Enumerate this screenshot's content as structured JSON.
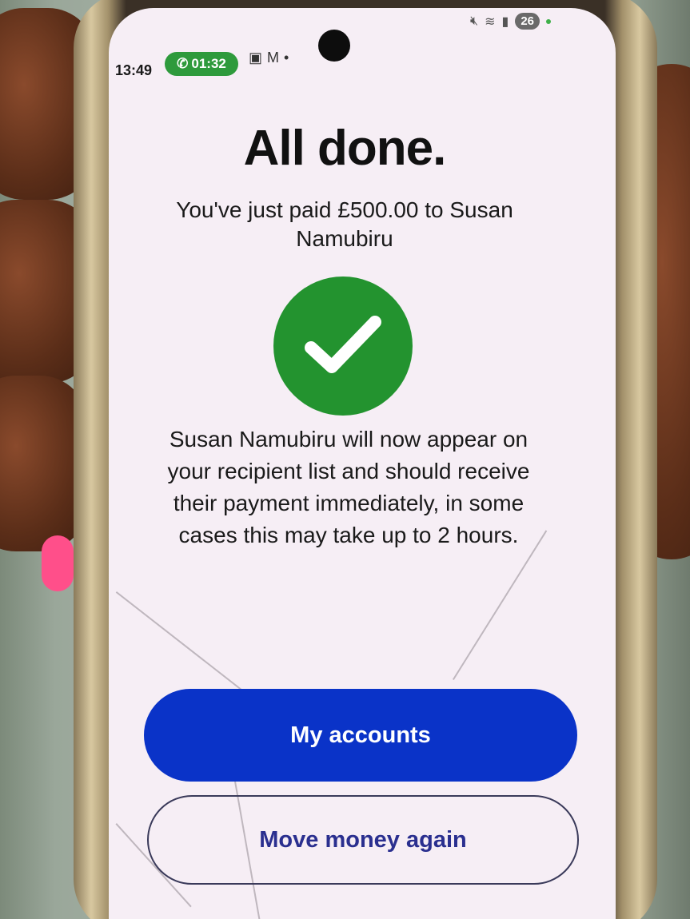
{
  "status_bar": {
    "time": "13:49",
    "call_timer": "01:32",
    "notification_icons": [
      "calendar-plus-icon",
      "gmail-icon",
      "more-dot-icon"
    ],
    "system_icons": [
      "mute-icon",
      "wifi-icon",
      "signal-icon"
    ],
    "battery": "26"
  },
  "main": {
    "title": "All done.",
    "paid_message": "You've just paid £500.00 to Susan Namubiru",
    "status_icon": "checkmark-icon",
    "info_message": "Susan Namubiru will now appear on your recipient list and should receive their payment immediately, in some cases this may take up to 2 hours."
  },
  "actions": {
    "primary_label": "My accounts",
    "secondary_label": "Move money again"
  },
  "colors": {
    "primary_button": "#0a33c8",
    "success_green": "#23932f",
    "secondary_text": "#2a2f8f",
    "screen_bg": "#f6eef5"
  }
}
